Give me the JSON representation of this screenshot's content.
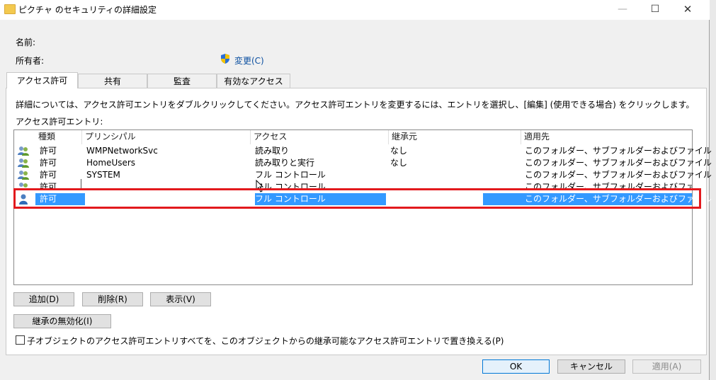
{
  "window": {
    "title": "ピクチャ のセキュリティの詳細設定",
    "minimize": "—",
    "maximize": "☐",
    "close": "✕"
  },
  "info": {
    "name_label": "名前:",
    "owner_label": "所有者:",
    "change_link": "変更(C)"
  },
  "tabs": [
    {
      "label": "アクセス許可",
      "active": true
    },
    {
      "label": "共有",
      "active": false
    },
    {
      "label": "監査",
      "active": false
    },
    {
      "label": "有効なアクセス",
      "active": false
    }
  ],
  "instructions": "詳細については、アクセス許可エントリをダブルクリックしてください。アクセス許可エントリを変更するには、エントリを選択し、[編集] (使用できる場合) をクリックします。",
  "entries_label": "アクセス許可エントリ:",
  "table": {
    "columns": [
      "種類",
      "プリンシパル",
      "アクセス",
      "継承元",
      "適用先"
    ],
    "rows": [
      {
        "type": "許可",
        "principal": "WMPNetworkSvc",
        "access": "読み取り",
        "inherited": "なし",
        "applies": "このフォルダー、サブフォルダーおよびファイル"
      },
      {
        "type": "許可",
        "principal": "HomeUsers",
        "access": "読み取りと実行",
        "inherited": "なし",
        "applies": "このフォルダー、サブフォルダーおよびファイル"
      },
      {
        "type": "許可",
        "principal": "SYSTEM",
        "access": "フル コントロール",
        "inherited": "",
        "applies": "このフォルダー、サブフォルダーおよびファイル"
      },
      {
        "type": "許可",
        "principal": "",
        "access": "フル コントロール",
        "inherited": "",
        "applies": "このフォルダー、サブフォルダーおよびファイル"
      },
      {
        "type": "許可",
        "principal": "",
        "access": "フル コントロール",
        "inherited": "",
        "applies": "このフォルダー、サブフォルダーおよびファイル"
      }
    ]
  },
  "buttons": {
    "add": "追加(D)",
    "remove": "削除(R)",
    "view": "表示(V)",
    "disable_inheritance": "継承の無効化(I)",
    "ok": "OK",
    "cancel": "キャンセル",
    "apply": "適用(A)"
  },
  "replace_checkbox_label": "子オブジェクトのアクセス許可エントリすべてを、このオブジェクトからの継承可能なアクセス許可エントリで置き換える(P)",
  "colors": {
    "selection": "#3399ff",
    "highlight_box": "#e2191d",
    "link": "#0b4fa0"
  }
}
